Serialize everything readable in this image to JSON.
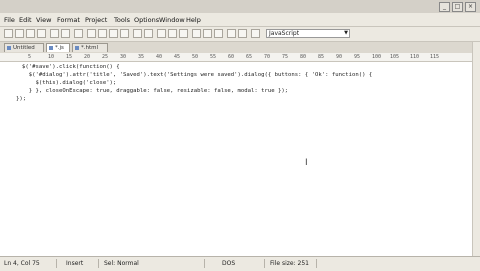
{
  "window": {
    "title": "",
    "controls": [
      "minimize",
      "maximize",
      "close"
    ]
  },
  "menu": [
    "File",
    "Edit",
    "View",
    "Format",
    "Project",
    "Tools",
    "Options",
    "Window",
    "Help"
  ],
  "toolbar": {
    "language": "JavaScript"
  },
  "tabs": [
    {
      "label": "Untitled"
    },
    {
      "label": "*.js"
    },
    {
      "label": "*.html"
    }
  ],
  "ruler": [
    "5",
    "10",
    "15",
    "20",
    "25",
    "30",
    "35",
    "40",
    "45",
    "50",
    "55",
    "60",
    "65",
    "70",
    "75",
    "80",
    "85",
    "90",
    "95",
    "100",
    "105",
    "110",
    "115"
  ],
  "code": [
    "$('#save').click(function() {",
    "  $('#dialog').attr('title', 'Saved').text('Settings were saved').dialog({ buttons: { 'Ok': function() {",
    "    $(this).dialog('close');",
    "  } }, closeOnEscape: true, draggable: false, resizable: false, modal: true });",
    "});"
  ],
  "status": {
    "position": "Ln 4, Col 75",
    "mode": "Insert",
    "selection": "Sel: Normal",
    "encoding": "DOS",
    "filesize": "File size: 251"
  }
}
